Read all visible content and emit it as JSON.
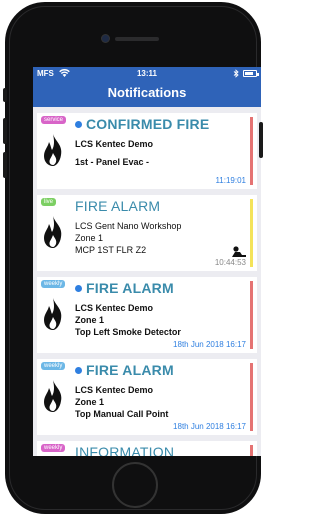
{
  "status_bar": {
    "carrier": "MFS",
    "wifi_icon": "wifi-icon",
    "time": "13:11",
    "bluetooth_icon": "bluetooth-icon",
    "battery_icon": "battery-icon"
  },
  "header": {
    "title": "Notifications"
  },
  "notifications": [
    {
      "badge": "service",
      "badge_color": "#d864c8",
      "unread": true,
      "title": "CONFIRMED FIRE",
      "line1": "LCS Kentec Demo",
      "line2": "1st - Panel Evac -",
      "line3": "",
      "time": "11:19:01",
      "time_color": "#2f7fe0",
      "bar_color": "#e57373"
    },
    {
      "badge": "live",
      "badge_color": "#7ccf63",
      "unread": false,
      "title": "FIRE ALARM",
      "line1": "LCS Gent Nano Workshop",
      "line2": "Zone 1",
      "line3": "MCP 1ST FLR Z2",
      "time": "10:44:53",
      "time_color": "#888888",
      "bar_color": "#f4e35a",
      "extra_icon": "user-icon"
    },
    {
      "badge": "weekly",
      "badge_color": "#6cb7e6",
      "unread": true,
      "title": "FIRE ALARM",
      "line1": "LCS Kentec Demo",
      "line2": "Zone 1",
      "line3": "Top Left Smoke Detector",
      "time": "18th Jun 2018 16:17",
      "time_color": "#2f7fe0",
      "bar_color": "#e57373"
    },
    {
      "badge": "weekly",
      "badge_color": "#6cb7e6",
      "unread": true,
      "title": "FIRE ALARM",
      "line1": "LCS Kentec Demo",
      "line2": "Zone 1",
      "line3": "Top Manual Call Point",
      "time": "18th Jun 2018 16:17",
      "time_color": "#2f7fe0",
      "bar_color": "#e57373"
    },
    {
      "badge": "weekly",
      "badge_color": "#d864c8",
      "unread": false,
      "title": "INFORMATION",
      "bar_color": "#e57373"
    }
  ],
  "colors": {
    "brand_blue": "#2f63b8",
    "title_teal": "#3a8bab",
    "unread_dot": "#2f7fe0"
  },
  "flame_icon": "fire-icon"
}
